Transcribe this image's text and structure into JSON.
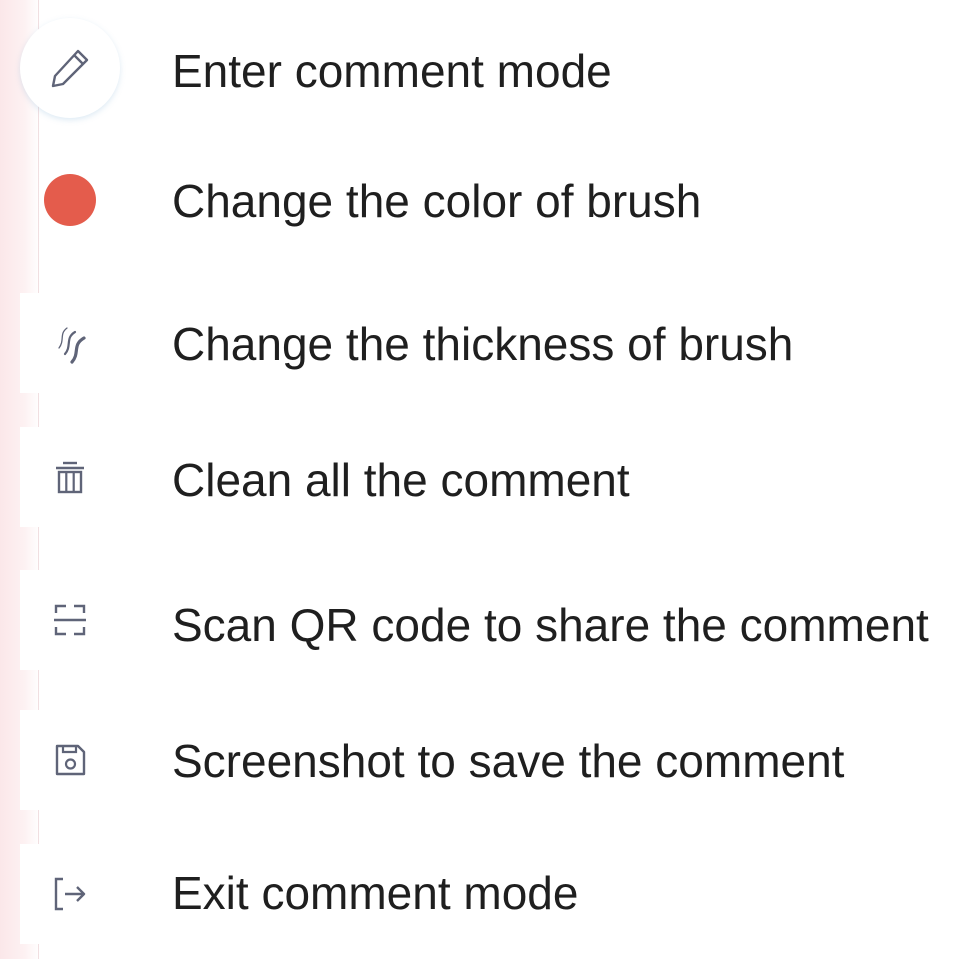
{
  "toolbar": {
    "items": [
      {
        "id": "enter",
        "icon": "pencil-icon",
        "label": "Enter comment mode"
      },
      {
        "id": "color",
        "icon": "color-dot-icon",
        "label": "Change the color of brush"
      },
      {
        "id": "thickness",
        "icon": "brush-thickness-icon",
        "label": "Change the thickness of brush"
      },
      {
        "id": "clean",
        "icon": "trash-icon",
        "label": "Clean all the comment"
      },
      {
        "id": "qr",
        "icon": "scan-icon",
        "label": "Scan QR code to share the comment"
      },
      {
        "id": "screenshot",
        "icon": "save-icon",
        "label": "Screenshot to save the comment"
      },
      {
        "id": "exit",
        "icon": "exit-icon",
        "label": "Exit comment mode"
      }
    ]
  },
  "colors": {
    "brush": "#e45c4c",
    "icon": "#5f6478",
    "text": "#1f1f1f",
    "sidebar": "#fbe7e9"
  }
}
